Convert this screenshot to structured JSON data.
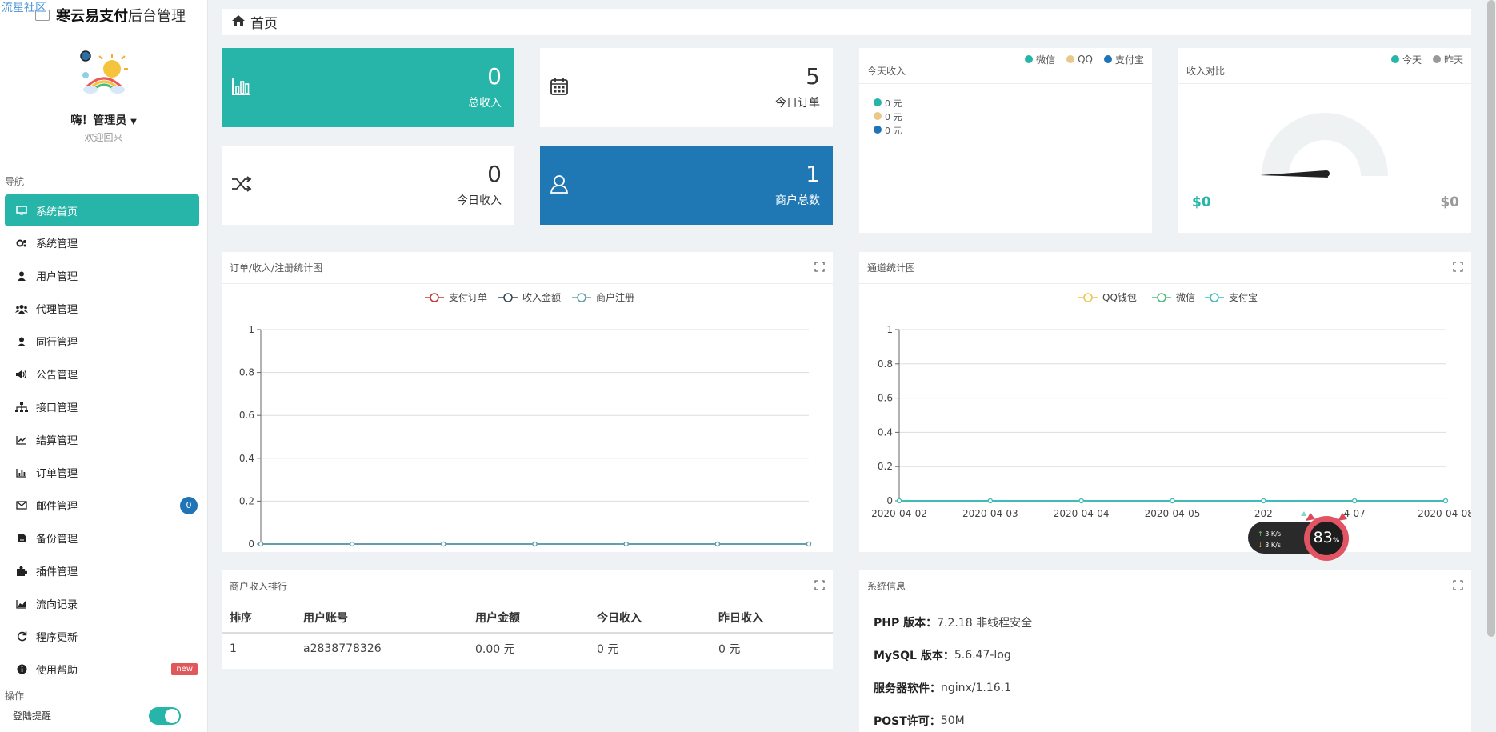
{
  "brand": {
    "watermark": "流星社区",
    "title_bold": "寒云易支付",
    "title_rest": "后台管理"
  },
  "user": {
    "name": "嗨！管理员",
    "welcome": "欢迎回来"
  },
  "nav": {
    "section_label": "导航",
    "items": [
      {
        "label": "系统首页",
        "icon": "monitor-icon"
      },
      {
        "label": "系统管理",
        "icon": "gears-icon"
      },
      {
        "label": "用户管理",
        "icon": "user-icon"
      },
      {
        "label": "代理管理",
        "icon": "users-icon"
      },
      {
        "label": "同行管理",
        "icon": "user-icon"
      },
      {
        "label": "公告管理",
        "icon": "volume-icon"
      },
      {
        "label": "接口管理",
        "icon": "sitemap-icon"
      },
      {
        "label": "结算管理",
        "icon": "line-chart-icon"
      },
      {
        "label": "订单管理",
        "icon": "bar-chart-icon"
      },
      {
        "label": "邮件管理",
        "icon": "envelope-icon",
        "badge": "0"
      },
      {
        "label": "备份管理",
        "icon": "file-icon"
      },
      {
        "label": "插件管理",
        "icon": "puzzle-icon"
      },
      {
        "label": "流向记录",
        "icon": "area-chart-icon"
      },
      {
        "label": "程序更新",
        "icon": "refresh-icon"
      },
      {
        "label": "使用帮助",
        "icon": "info-icon",
        "badge_new": "new"
      }
    ],
    "op_label": "操作",
    "toggle_label": "登陆提醒"
  },
  "breadcrumb": {
    "title": "首页"
  },
  "stats": {
    "total_income": {
      "value": "0",
      "label": "总收入"
    },
    "today_orders": {
      "value": "5",
      "label": "今日订单"
    },
    "today_income": {
      "value": "0",
      "label": "今日收入"
    },
    "merchants": {
      "value": "1",
      "label": "商户总数"
    }
  },
  "today_panel": {
    "title": "今天收入",
    "legend": [
      "微信",
      "QQ",
      "支付宝"
    ],
    "rows": [
      "0 元",
      "0 元",
      "0 元"
    ],
    "colors": [
      "#26b5a8",
      "#e8c98a",
      "#1f74b8"
    ]
  },
  "compare_panel": {
    "title": "收入对比",
    "legend": [
      "今天",
      "昨天"
    ],
    "left_value": "$0",
    "right_value": "$0",
    "gauge_level": 0
  },
  "chart1_panel": {
    "title": "订单/收入/注册统计图"
  },
  "chart2_panel": {
    "title": "通道统计图"
  },
  "rank_panel": {
    "title": "商户收入排行",
    "headers": [
      "排序",
      "用户账号",
      "用户金额",
      "今日收入",
      "昨日收入"
    ],
    "rows": [
      [
        "1",
        "a2838778326",
        "0.00 元",
        "0 元",
        "0 元"
      ]
    ]
  },
  "sys_panel": {
    "title": "系统信息",
    "rows": [
      {
        "k": "PHP 版本：",
        "v": "7.2.18 非线程安全"
      },
      {
        "k": "MySQL 版本：",
        "v": "5.6.47-log"
      },
      {
        "k": "服务器软件：",
        "v": "nginx/1.16.1"
      },
      {
        "k": "POST许可：",
        "v": "50M"
      }
    ]
  },
  "net_widget": {
    "up": "3",
    "down": "3",
    "unit": "K/s",
    "percent": "83",
    "pct_sign": "%"
  },
  "chart_data": [
    {
      "type": "line",
      "series": [
        {
          "name": "支付订单",
          "color": "#c23531",
          "values": [
            0,
            0,
            0,
            0,
            0,
            0,
            0
          ]
        },
        {
          "name": "收入金额",
          "color": "#2f4554",
          "values": [
            0,
            0,
            0,
            0,
            0,
            0,
            0
          ]
        },
        {
          "name": "商户注册",
          "color": "#61a0a8",
          "values": [
            0,
            0,
            0,
            0,
            0,
            0,
            0
          ]
        }
      ],
      "y_ticks": [
        "0",
        "0.2",
        "0.4",
        "0.6",
        "0.8",
        "1"
      ],
      "ylim": [
        0,
        1
      ]
    },
    {
      "type": "line",
      "x": [
        "2020-04-02",
        "2020-04-03",
        "2020-04-04",
        "2020-04-05",
        "2020-04-06",
        "2020-04-07",
        "2020-04-08"
      ],
      "x_tick_labels": [
        "2020-04-02",
        "2020-04-03",
        "2020-04-04",
        "2020-04-05",
        "202",
        "4-07",
        "2020-04-08"
      ],
      "series": [
        {
          "name": "QQ钱包",
          "color": "#e8c34a",
          "values": [
            0,
            0,
            0,
            0,
            0,
            0,
            0
          ]
        },
        {
          "name": "微信",
          "color": "#4cba7a",
          "values": [
            0,
            0,
            0,
            0,
            0,
            0,
            0
          ]
        },
        {
          "name": "支付宝",
          "color": "#3fbcb8",
          "values": [
            0,
            0,
            0,
            0,
            0,
            0,
            0
          ]
        }
      ],
      "y_ticks": [
        "0",
        "0.2",
        "0.4",
        "0.6",
        "0.8",
        "1"
      ],
      "ylim": [
        0,
        1
      ]
    }
  ]
}
